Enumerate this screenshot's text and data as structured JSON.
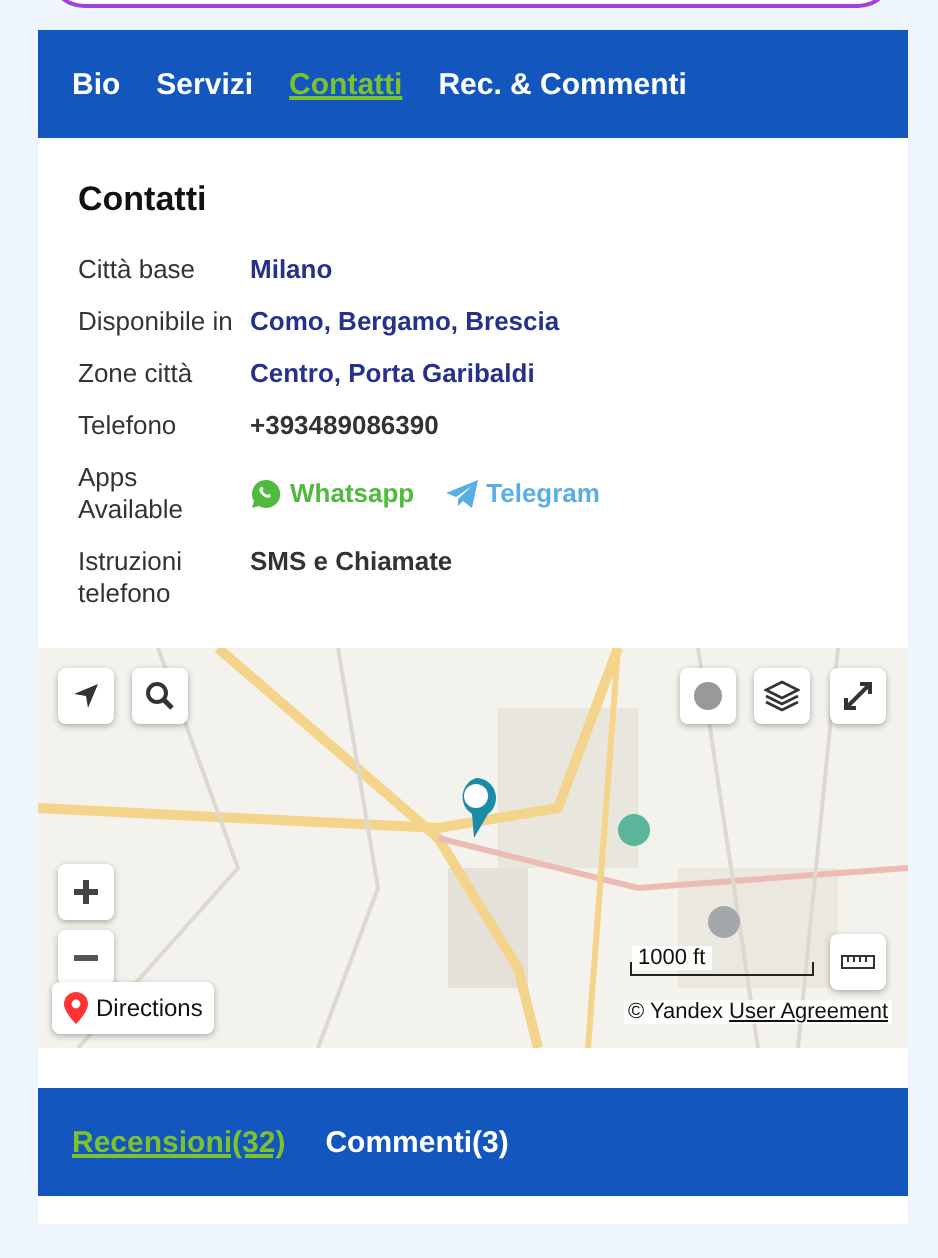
{
  "top_tabs": [
    {
      "label": "Bio",
      "selected": false
    },
    {
      "label": "Servizi",
      "selected": false
    },
    {
      "label": "Contatti",
      "selected": true
    },
    {
      "label": "Rec. & Commenti",
      "selected": false
    }
  ],
  "contacts": {
    "title": "Contatti",
    "rows": [
      {
        "label": "Città base",
        "kind": "link",
        "value": "Milano"
      },
      {
        "label": "Disponibile in",
        "kind": "link",
        "value": "Como, Bergamo, Brescia"
      },
      {
        "label": "Zone città",
        "kind": "link",
        "value": "Centro, Porta Garibaldi"
      },
      {
        "label": "Telefono",
        "kind": "text",
        "value": "+393489086390"
      },
      {
        "label": "Apps Available",
        "kind": "apps",
        "apps": [
          {
            "kind": "whatsapp",
            "label": "Whatsapp"
          },
          {
            "kind": "telegram",
            "label": "Telegram"
          }
        ]
      },
      {
        "label": "Istruzioni telefono",
        "kind": "text",
        "value": "SMS e Chiamate"
      }
    ]
  },
  "map": {
    "scale": "1000 ft",
    "directions": "Directions",
    "copyright": "© Yandex",
    "agreement": "User Agreement"
  },
  "bottom_tabs": [
    {
      "label": "Recensioni(32)",
      "selected": true
    },
    {
      "label": "Commenti(3)",
      "selected": false
    }
  ]
}
